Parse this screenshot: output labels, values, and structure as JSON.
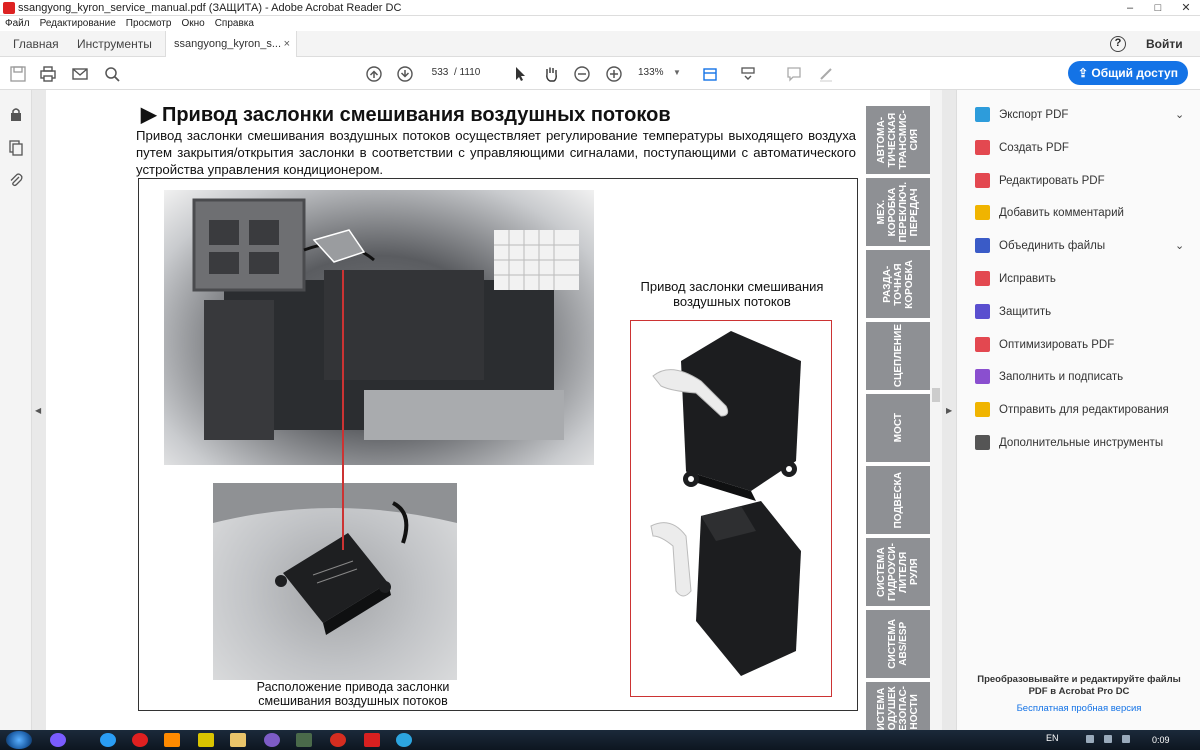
{
  "window": {
    "title": "ssangyong_kyron_service_manual.pdf (ЗАЩИТА) - Adobe Acrobat Reader DC",
    "controls": [
      "–",
      "□",
      "✕"
    ]
  },
  "menu": [
    "Файл",
    "Редактирование",
    "Просмотр",
    "Окно",
    "Справка"
  ],
  "tabs": {
    "home": "Главная",
    "tools": "Инструменты",
    "document": "ssangyong_kyron_s...",
    "close": "×",
    "login": "Войти",
    "help": "?"
  },
  "toolbar": {
    "page_current": "533",
    "page_total": "/ 1110",
    "zoom": "133%",
    "share_label": "Общий доступ"
  },
  "document": {
    "heading": "▶ Привод заслонки смешивания воздушных потоков",
    "paragraph": "Привод заслонки смешивания воздушных потоков осуществляет регулирование температуры выходящего воздуха путем закрытия/открытия заслонки в соответствии с управляющими сигналами, поступающими с автоматического устройства управления кондиционером.",
    "caption_right": "Привод заслонки смешивания воздушных потоков",
    "caption_bottom": "Расположение привода заслонки смешивания воздушных потоков",
    "section_tabs": [
      "АВТОМА-\nТИЧЕСКАЯ\nТРАНСМИС-\nСИЯ",
      "МЕХ.\nКОРОБКА\nПЕРЕКЛЮЧ.\nПЕРЕДАЧ",
      "РАЗДА-\nТОЧНАЯ\nКОРОБКА",
      "СЦЕПЛЕНИЕ",
      "МОСТ",
      "ПОДВЕСКА",
      "СИСТЕМА\nГИДРОУСИ-\nЛИТЕЛЯ\nРУЛЯ",
      "СИСТЕМА\nABS/ESP",
      "СИСТЕМА\nПОДУШЕК\nБЕЗОПАС-\nНОСТИ"
    ]
  },
  "right_panel": {
    "tools": [
      {
        "label": "Экспорт PDF",
        "color": "#2d9cdb",
        "icon": "export-pdf-icon",
        "expand": "⌄"
      },
      {
        "label": "Создать PDF",
        "color": "#e34850",
        "icon": "create-pdf-icon",
        "expand": ""
      },
      {
        "label": "Редактировать PDF",
        "color": "#e34850",
        "icon": "edit-pdf-icon",
        "expand": ""
      },
      {
        "label": "Добавить комментарий",
        "color": "#f0b400",
        "icon": "comment-icon",
        "expand": ""
      },
      {
        "label": "Объединить файлы",
        "color": "#3a5bc7",
        "icon": "combine-files-icon",
        "expand": "⌄"
      },
      {
        "label": "Исправить",
        "color": "#e34850",
        "icon": "fix-icon",
        "expand": ""
      },
      {
        "label": "Защитить",
        "color": "#5a4fcf",
        "icon": "protect-icon",
        "expand": ""
      },
      {
        "label": "Оптимизировать PDF",
        "color": "#e34850",
        "icon": "optimize-pdf-icon",
        "expand": ""
      },
      {
        "label": "Заполнить и подписать",
        "color": "#8a4fcf",
        "icon": "fill-sign-icon",
        "expand": ""
      },
      {
        "label": "Отправить для редактирования",
        "color": "#f0b400",
        "icon": "send-review-icon",
        "expand": ""
      },
      {
        "label": "Дополнительные инструменты",
        "color": "#555555",
        "icon": "more-tools-icon",
        "expand": ""
      }
    ],
    "promo": "Преобразовывайте и редактируйте файлы PDF в Acrobat Pro DC",
    "trial_link": "Бесплатная пробная версия"
  },
  "taskbar": {
    "lang": "EN",
    "time": "0:09"
  }
}
